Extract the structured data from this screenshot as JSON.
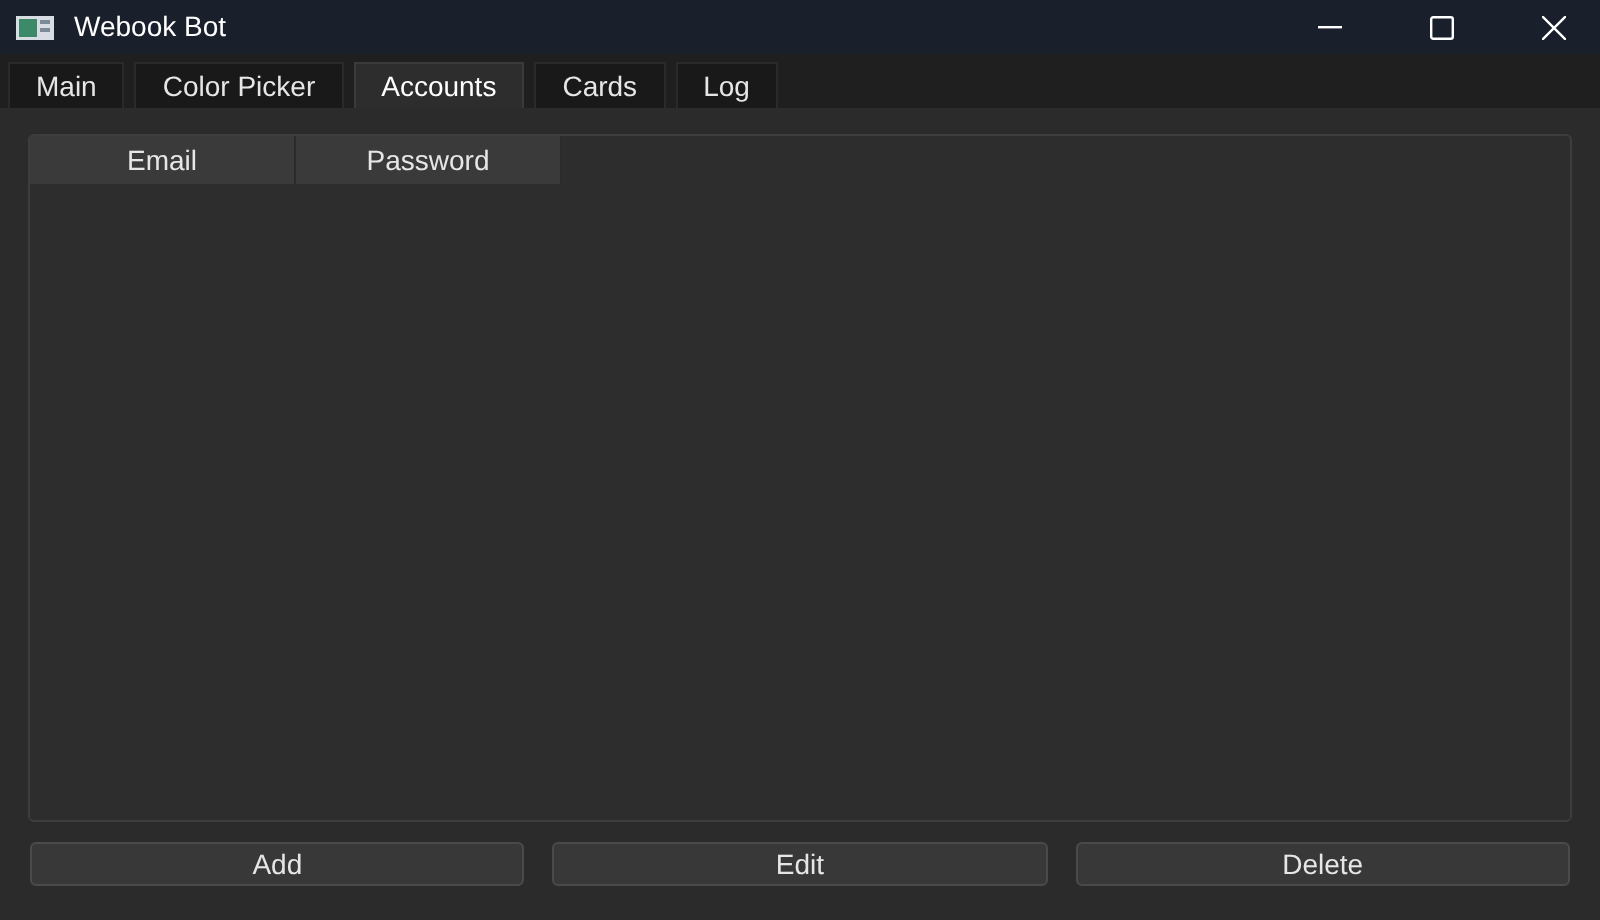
{
  "window": {
    "title": "Webook Bot"
  },
  "tabs": [
    {
      "label": "Main",
      "selected": false
    },
    {
      "label": "Color Picker",
      "selected": false
    },
    {
      "label": "Accounts",
      "selected": true
    },
    {
      "label": "Cards",
      "selected": false
    },
    {
      "label": "Log",
      "selected": false
    }
  ],
  "table": {
    "columns": [
      "Email",
      "Password"
    ]
  },
  "buttons": [
    "Add",
    "Edit",
    "Delete"
  ]
}
